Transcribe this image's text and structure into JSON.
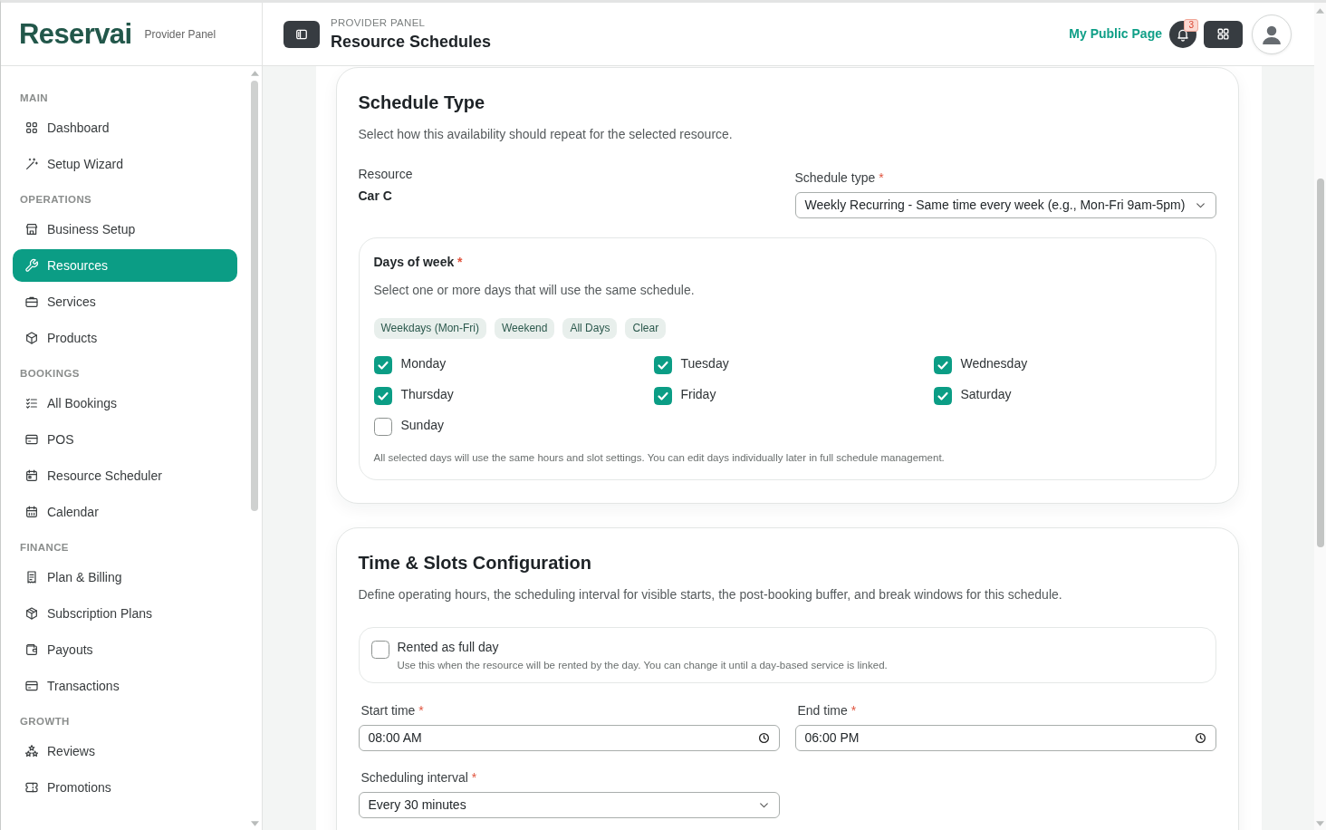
{
  "sidebar": {
    "brand": {
      "logo": "Reservai",
      "tagline": "Provider Panel"
    },
    "sections": [
      {
        "title": "MAIN",
        "items": [
          {
            "label": "Dashboard",
            "selected": false
          },
          {
            "label": "Setup Wizard",
            "selected": false
          }
        ]
      },
      {
        "title": "OPERATIONS",
        "items": [
          {
            "label": "Business Setup",
            "selected": false
          },
          {
            "label": "Resources",
            "selected": true
          },
          {
            "label": "Services",
            "selected": false
          },
          {
            "label": "Products",
            "selected": false
          }
        ]
      },
      {
        "title": "BOOKINGS",
        "items": [
          {
            "label": "All Bookings",
            "selected": false
          },
          {
            "label": "POS",
            "selected": false
          },
          {
            "label": "Resource Scheduler",
            "selected": false
          },
          {
            "label": "Calendar",
            "selected": false
          }
        ]
      },
      {
        "title": "FINANCE",
        "items": [
          {
            "label": "Plan & Billing",
            "selected": false
          },
          {
            "label": "Subscription Plans",
            "selected": false
          },
          {
            "label": "Payouts",
            "selected": false
          },
          {
            "label": "Transactions",
            "selected": false
          }
        ]
      },
      {
        "title": "GROWTH",
        "items": [
          {
            "label": "Reviews",
            "selected": false
          },
          {
            "label": "Promotions",
            "selected": false
          }
        ]
      }
    ]
  },
  "header": {
    "eyebrow": "PROVIDER PANEL",
    "title": "Resource Schedules",
    "public_link": "My Public Page",
    "notification_count": "3"
  },
  "schedule_type_card": {
    "title": "Schedule Type",
    "description": "Select how this availability should repeat for the selected resource.",
    "resource": {
      "label": "Resource",
      "value": "Car C"
    },
    "schedule_type": {
      "label": "Schedule type",
      "required_mark": "*",
      "value": "Weekly Recurring - Same time every week (e.g., Mon-Fri 9am-5pm)"
    },
    "days_of_week": {
      "title": "Days of week",
      "required_mark": "*",
      "description": "Select one or more days that will use the same schedule.",
      "quick_picks": [
        "Weekdays (Mon-Fri)",
        "Weekend",
        "All Days",
        "Clear"
      ],
      "days": [
        {
          "label": "Monday",
          "checked": true
        },
        {
          "label": "Tuesday",
          "checked": true
        },
        {
          "label": "Wednesday",
          "checked": true
        },
        {
          "label": "Thursday",
          "checked": true
        },
        {
          "label": "Friday",
          "checked": true
        },
        {
          "label": "Saturday",
          "checked": true
        },
        {
          "label": "Sunday",
          "checked": false
        }
      ],
      "note": "All selected days will use the same hours and slot settings. You can edit days individually later in full schedule management."
    }
  },
  "time_slots_card": {
    "title": "Time & Slots Configuration",
    "description": "Define operating hours, the scheduling interval for visible starts, the post-booking buffer, and break windows for this schedule.",
    "full_day": {
      "label": "Rented as full day",
      "help": "Use this when the resource will be rented by the day. You can change it until a day-based service is linked.",
      "checked": false
    },
    "start_time": {
      "label": "Start time",
      "required_mark": "*",
      "value": "08:00 AM"
    },
    "end_time": {
      "label": "End time",
      "required_mark": "*",
      "value": "06:00 PM"
    },
    "interval": {
      "label": "Scheduling interval",
      "required_mark": "*",
      "value": "Every 30 minutes"
    }
  }
}
